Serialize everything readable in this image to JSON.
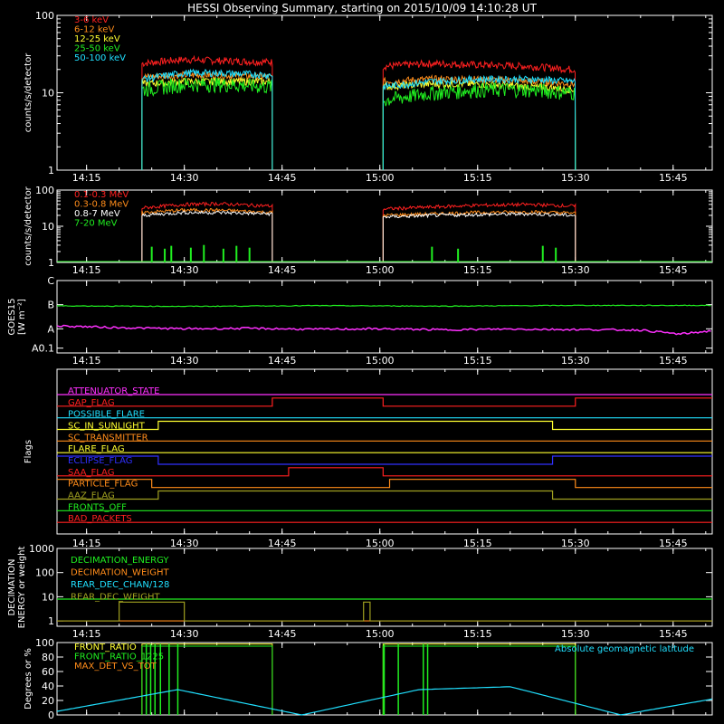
{
  "title": "HESSI Observing Summary, starting on 2015/10/09 14:10:28 UT",
  "time_ticks": [
    "14:15",
    "14:30",
    "14:45",
    "15:00",
    "15:15",
    "15:30",
    "15:45"
  ],
  "colors": {
    "red": "#ff2020",
    "orange": "#ff8c1a",
    "yellow": "#ffff30",
    "green": "#20ee20",
    "cyan": "#20e0ff",
    "magenta": "#ff30ff",
    "blue": "#3030ff",
    "olive": "#a0a020",
    "white": "#ffffff"
  },
  "chart_data": [
    {
      "id": "low-energy",
      "type": "line",
      "ylabel": "counts/s/detector",
      "yscale": "log",
      "ylim": [
        1,
        100
      ],
      "y_ticks": [
        "1",
        "10",
        "100"
      ],
      "xlim": [
        "14:10:28",
        "15:51:00"
      ],
      "legend": "top-left",
      "observing_intervals": [
        [
          "14:23:30",
          "14:43:30"
        ],
        [
          "15:00:30",
          "15:30:00"
        ]
      ],
      "series": [
        {
          "name": "3-6 keV",
          "color": "red",
          "x": [
            "14:23:30",
            "14:30",
            "14:35",
            "14:43:30",
            "15:00:30",
            "15:08",
            "15:15",
            "15:23",
            "15:30:00"
          ],
          "values": [
            24,
            27,
            26,
            25,
            22,
            24,
            23,
            22,
            20
          ]
        },
        {
          "name": "6-12 keV",
          "color": "orange",
          "x": [
            "14:23:30",
            "14:30",
            "14:35",
            "14:43:30",
            "15:00:30",
            "15:08",
            "15:15",
            "15:23",
            "15:30:00"
          ],
          "values": [
            16,
            17,
            17,
            16,
            14,
            15,
            15,
            14,
            13
          ]
        },
        {
          "name": "12-25 keV",
          "color": "yellow",
          "x": [
            "14:23:30",
            "14:30",
            "14:35",
            "14:43:30",
            "15:00:30",
            "15:08",
            "15:15",
            "15:23",
            "15:30:00"
          ],
          "values": [
            13,
            14,
            14,
            14,
            12,
            13,
            13,
            12,
            11
          ]
        },
        {
          "name": "25-50 keV",
          "color": "green",
          "x": [
            "14:23:30",
            "14:30",
            "14:35",
            "14:43:30",
            "15:00:30",
            "15:08",
            "15:15",
            "15:23",
            "15:30:00"
          ],
          "values": [
            11,
            13,
            13,
            12,
            8,
            10,
            11,
            11,
            10
          ]
        },
        {
          "name": "50-100 keV",
          "color": "cyan",
          "x": [
            "14:23:30",
            "14:30",
            "14:35",
            "14:43:30",
            "15:00:30",
            "15:08",
            "15:15",
            "15:23",
            "15:30:00"
          ],
          "values": [
            15,
            18,
            18,
            17,
            12,
            14,
            15,
            15,
            14
          ]
        }
      ]
    },
    {
      "id": "high-energy",
      "type": "line",
      "ylabel": "counts/s/detector",
      "yscale": "log",
      "ylim": [
        1,
        100
      ],
      "y_ticks": [
        "1",
        "10",
        "100"
      ],
      "xlim": [
        "14:10:28",
        "15:51:00"
      ],
      "legend": "top-left",
      "series": [
        {
          "name": "0.1-0.3 MeV",
          "color": "red",
          "x": [
            "14:23:30",
            "14:30",
            "14:35",
            "14:43:30",
            "15:00:30",
            "15:08",
            "15:15",
            "15:23",
            "15:30:00"
          ],
          "values": [
            32,
            40,
            42,
            36,
            30,
            34,
            38,
            40,
            36
          ]
        },
        {
          "name": "0.3-0.8 MeV",
          "color": "orange",
          "x": [
            "14:23:30",
            "14:30",
            "14:35",
            "14:43:30",
            "15:00:30",
            "15:08",
            "15:15",
            "15:23",
            "15:30:00"
          ],
          "values": [
            24,
            28,
            28,
            24,
            20,
            22,
            24,
            25,
            23
          ]
        },
        {
          "name": "0.8-7 MeV",
          "color": "white",
          "x": [
            "14:23:30",
            "14:30",
            "14:35",
            "14:43:30",
            "15:00:30",
            "15:08",
            "15:15",
            "15:23",
            "15:30:00"
          ],
          "values": [
            20,
            24,
            24,
            22,
            18,
            20,
            21,
            22,
            20
          ]
        },
        {
          "name": "7-20 MeV",
          "color": "green",
          "x": [
            "14:25",
            "14:27",
            "14:28",
            "14:31",
            "14:33",
            "14:36",
            "14:38",
            "14:40",
            "15:08",
            "15:12",
            "15:25",
            "15:27"
          ],
          "values": [
            1.7,
            1.5,
            1.8,
            1.6,
            1.9,
            1.5,
            1.8,
            1.6,
            1.7,
            1.5,
            1.8,
            1.6
          ]
        }
      ]
    },
    {
      "id": "goes",
      "type": "line",
      "ylabel": "GOES15",
      "ylabel2": "[W m⁻²]",
      "y_ticks": [
        "A0.1",
        "A",
        "B",
        "C"
      ],
      "ylim": [
        0,
        3
      ],
      "xlim": [
        "14:10:28",
        "15:51:00"
      ],
      "series": [
        {
          "color": "green",
          "x": [
            "14:10:28",
            "14:30",
            "14:50",
            "15:10",
            "15:30",
            "15:51"
          ],
          "values": [
            1.95,
            1.93,
            1.96,
            1.94,
            1.97,
            1.97
          ]
        },
        {
          "color": "magenta",
          "x": [
            "14:10:28",
            "14:20",
            "14:30",
            "14:40",
            "14:50",
            "15:00",
            "15:10",
            "15:20",
            "15:30",
            "15:40",
            "15:46",
            "15:51"
          ],
          "values": [
            1.12,
            1.05,
            1.0,
            1.02,
            0.98,
            1.0,
            0.96,
            0.99,
            0.97,
            0.95,
            0.78,
            0.92
          ]
        }
      ]
    },
    {
      "id": "flags",
      "type": "line",
      "ylabel": "Flags",
      "xlim": [
        "14:10:28",
        "15:51:00"
      ],
      "series": [
        {
          "name": "ATTENUATOR_STATE",
          "color": "magenta",
          "x": [],
          "values": []
        },
        {
          "name": "GAP_FLAG",
          "color": "red",
          "x": [
            "14:10:28",
            "14:43:30",
            "15:00:30",
            "15:30:00"
          ],
          "values": [
            0,
            1,
            0,
            1
          ]
        },
        {
          "name": "POSSIBLE_FLARE",
          "color": "cyan",
          "x": [],
          "values": []
        },
        {
          "name": "SC_IN_SUNLIGHT",
          "color": "yellow",
          "x": [
            "14:10:28",
            "14:26:00",
            "15:26:30"
          ],
          "values": [
            0,
            1,
            0
          ]
        },
        {
          "name": "SC_TRANSMITTER",
          "color": "orange",
          "x": [],
          "values": []
        },
        {
          "name": "FLARE_FLAG",
          "color": "yellow",
          "x": [],
          "values": []
        },
        {
          "name": "ECLIPSE_FLAG",
          "color": "blue",
          "x": [
            "14:10:28",
            "14:26:00",
            "15:26:30"
          ],
          "values": [
            1,
            0,
            1
          ]
        },
        {
          "name": "SAA_FLAG",
          "color": "red",
          "x": [
            "14:10:28",
            "14:46:00",
            "15:00:30"
          ],
          "values": [
            0,
            1,
            0
          ]
        },
        {
          "name": "PARTICLE_FLAG",
          "color": "orange",
          "x": [
            "14:10:28",
            "14:25:00",
            "14:26:00",
            "15:01:30",
            "15:30:00"
          ],
          "values": [
            1,
            0,
            0,
            1,
            0
          ]
        },
        {
          "name": "AAZ_FLAG",
          "color": "olive",
          "x": [
            "14:10:28",
            "14:26:00",
            "15:26:30"
          ],
          "values": [
            0,
            1,
            0
          ]
        },
        {
          "name": "FRONTS_OFF",
          "color": "green",
          "x": [],
          "values": []
        },
        {
          "name": "BAD_PACKETS",
          "color": "red",
          "x": [],
          "values": []
        }
      ]
    },
    {
      "id": "decimation",
      "type": "line",
      "ylabel": "DECIMATION",
      "ylabel2": "ENERGY or weight",
      "yscale": "log",
      "ylim": [
        0.6,
        1000
      ],
      "y_ticks": [
        "1",
        "10",
        "100",
        "1000"
      ],
      "xlim": [
        "14:10:28",
        "15:51:00"
      ],
      "legend": "top-left",
      "series": [
        {
          "name": "DECIMATION_ENERGY",
          "color": "green",
          "x": [
            "14:10:28",
            "15:51:00"
          ],
          "values": [
            8,
            8
          ]
        },
        {
          "name": "DECIMATION_WEIGHT",
          "color": "orange",
          "x": [
            "14:10:28",
            "15:51:00"
          ],
          "values": [
            1,
            1
          ]
        },
        {
          "name": "REAR_DEC_CHAN/128",
          "color": "cyan",
          "x": [],
          "values": []
        },
        {
          "name": "REAR_DEC_WEIGHT",
          "color": "olive",
          "x": [
            "14:10:28",
            "14:20:00",
            "14:30:00",
            "14:57:30",
            "14:58:30",
            "15:51:00"
          ],
          "values": [
            1,
            6,
            1,
            6,
            1,
            1
          ]
        }
      ]
    },
    {
      "id": "ratios",
      "type": "line",
      "ylabel": "Degrees or %",
      "ylim": [
        0,
        100
      ],
      "y_ticks": [
        "0",
        "20",
        "40",
        "60",
        "80",
        "100"
      ],
      "xlim": [
        "14:10:28",
        "15:51:00"
      ],
      "legend": "top-left",
      "annotation": "Absolute geomagnetic latitude",
      "series": [
        {
          "name": "FRONT_RATIO",
          "color": "yellow",
          "x": [
            "14:23:30",
            "14:43:30",
            "15:00:30",
            "15:30:00"
          ],
          "values": [
            98,
            98,
            98,
            98
          ]
        },
        {
          "name": "FRONT_RATIO_1225",
          "color": "green",
          "x": [
            "14:23:30",
            "14:43:30",
            "15:00:30",
            "15:30:00"
          ],
          "values": [
            95,
            95,
            95,
            95
          ]
        },
        {
          "name": "MAX_DET_VS_TOT",
          "color": "orange",
          "x": [],
          "values": []
        },
        {
          "name": "Absolute geomagnetic latitude",
          "color": "cyan",
          "x": [
            "14:10:28",
            "14:29:00",
            "14:48:00",
            "15:06:00",
            "15:20:00",
            "15:37:00",
            "15:51:00"
          ],
          "values": [
            5,
            35,
            0,
            35,
            39,
            0,
            22
          ]
        }
      ]
    }
  ]
}
